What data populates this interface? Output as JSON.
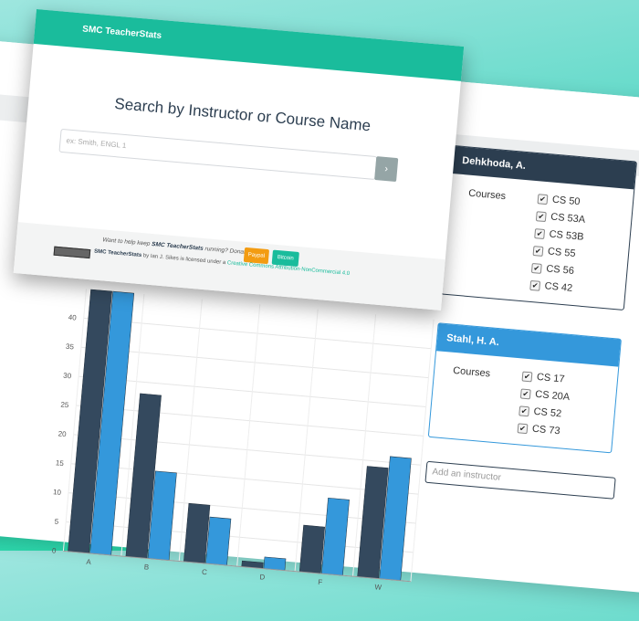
{
  "app": {
    "brand": "SMC TeacherStats"
  },
  "search": {
    "title": "Search by Instructor or Course Name",
    "placeholder": "ex: Smith, ENGL 1",
    "button_icon": "chevron-right-icon"
  },
  "footer": {
    "donate_prefix": "Want to help keep ",
    "donate_brand": "SMC TeacherStats",
    "donate_suffix": " running? Donate!",
    "paypal_label": "Paypal",
    "bitcoin_label": "Bitcoin",
    "license_brand": "SMC TeacherStats",
    "license_mid": " by Ian J. Sikes is licensed under a ",
    "license_link": "Creative Commons Attribution-NonCommercial 4.0"
  },
  "instructors": [
    {
      "name": "Dehkhoda, A.",
      "courses_label": "Courses",
      "courses": [
        "CS 50",
        "CS 53A",
        "CS 53B",
        "CS 55",
        "CS 56",
        "CS 42"
      ],
      "color": "#2c3e50"
    },
    {
      "name": "Stahl, H. A.",
      "courses_label": "Courses",
      "courses": [
        "CS 17",
        "CS 20A",
        "CS 52",
        "CS 73"
      ],
      "color": "#3498db"
    }
  ],
  "add_instructor_placeholder": "Add an instructor",
  "chart_data": {
    "type": "bar",
    "categories": [
      "A",
      "B",
      "C",
      "D",
      "F",
      "W"
    ],
    "series": [
      {
        "values": [
          45,
          28,
          10,
          1,
          8,
          19
        ],
        "color": "#34495e"
      },
      {
        "values": [
          45,
          15,
          8,
          2,
          13,
          21
        ],
        "color": "#3498db"
      }
    ],
    "yticks": [
      0,
      5,
      10,
      15,
      20,
      25,
      30,
      35,
      40
    ],
    "ylim": [
      0,
      45
    ],
    "grid": true
  }
}
